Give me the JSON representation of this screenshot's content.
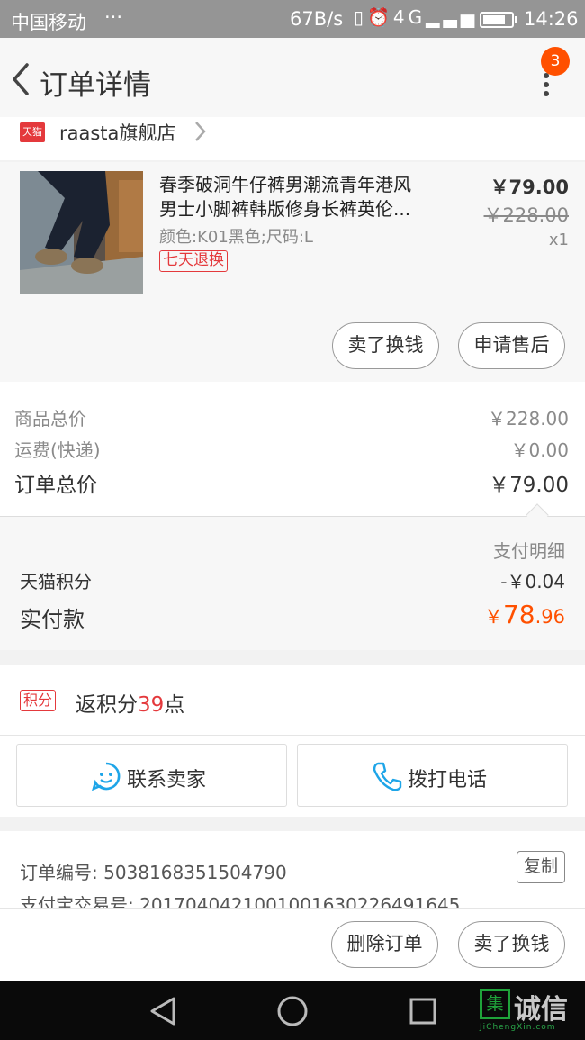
{
  "status_bar": {
    "carrier": "中国移动",
    "dots": "···",
    "speed": "67B/s",
    "network": "4G",
    "time": "14:26"
  },
  "header": {
    "title": "订单详情",
    "notification_count": "3"
  },
  "shop": {
    "badge": "天猫",
    "name": "raasta旗舰店"
  },
  "product": {
    "title_line1": "春季破洞牛仔裤男潮流青年港风",
    "title_line2": "男士小脚裤韩版修身长裤英伦...",
    "attributes": "颜色:K01黑色;尺码:L",
    "return_tag": "七天退换",
    "price": "￥79.00",
    "original_price": "￥228.00",
    "quantity": "x1",
    "sell_button": "卖了换钱",
    "after_sale_button": "申请售后"
  },
  "totals": {
    "goods_label": "商品总价",
    "goods_value": "￥228.00",
    "shipping_label": "运费(快递)",
    "shipping_value": "￥0.00",
    "order_label": "订单总价",
    "order_value": "￥79.00"
  },
  "pay_detail": {
    "title": "支付明细",
    "points_label": "天猫积分",
    "points_value": "-￥0.04",
    "paid_label": "实付款",
    "paid_currency": "￥",
    "paid_int": "78",
    "paid_dec": ".96"
  },
  "points": {
    "tag": "积分",
    "prefix": "返积分",
    "count": "39",
    "suffix": "点"
  },
  "contact": {
    "seller_button": "联系卖家",
    "call_button": "拨打电话"
  },
  "order_info": {
    "order_no_label": "订单编号:",
    "order_no": "5038168351504790",
    "alipay_label": "支付宝交易号:",
    "alipay_no": "2017040421001001630226491645",
    "copy_button": "复制"
  },
  "actions": {
    "delete_button": "删除订单",
    "sell_button": "卖了换钱"
  },
  "watermark": {
    "logo": "集",
    "text": "诚信",
    "sub": "JiChengXin.com"
  },
  "colors": {
    "accent": "#ff5000",
    "tmall_red": "#e4393c",
    "status_bar": "#959595"
  }
}
